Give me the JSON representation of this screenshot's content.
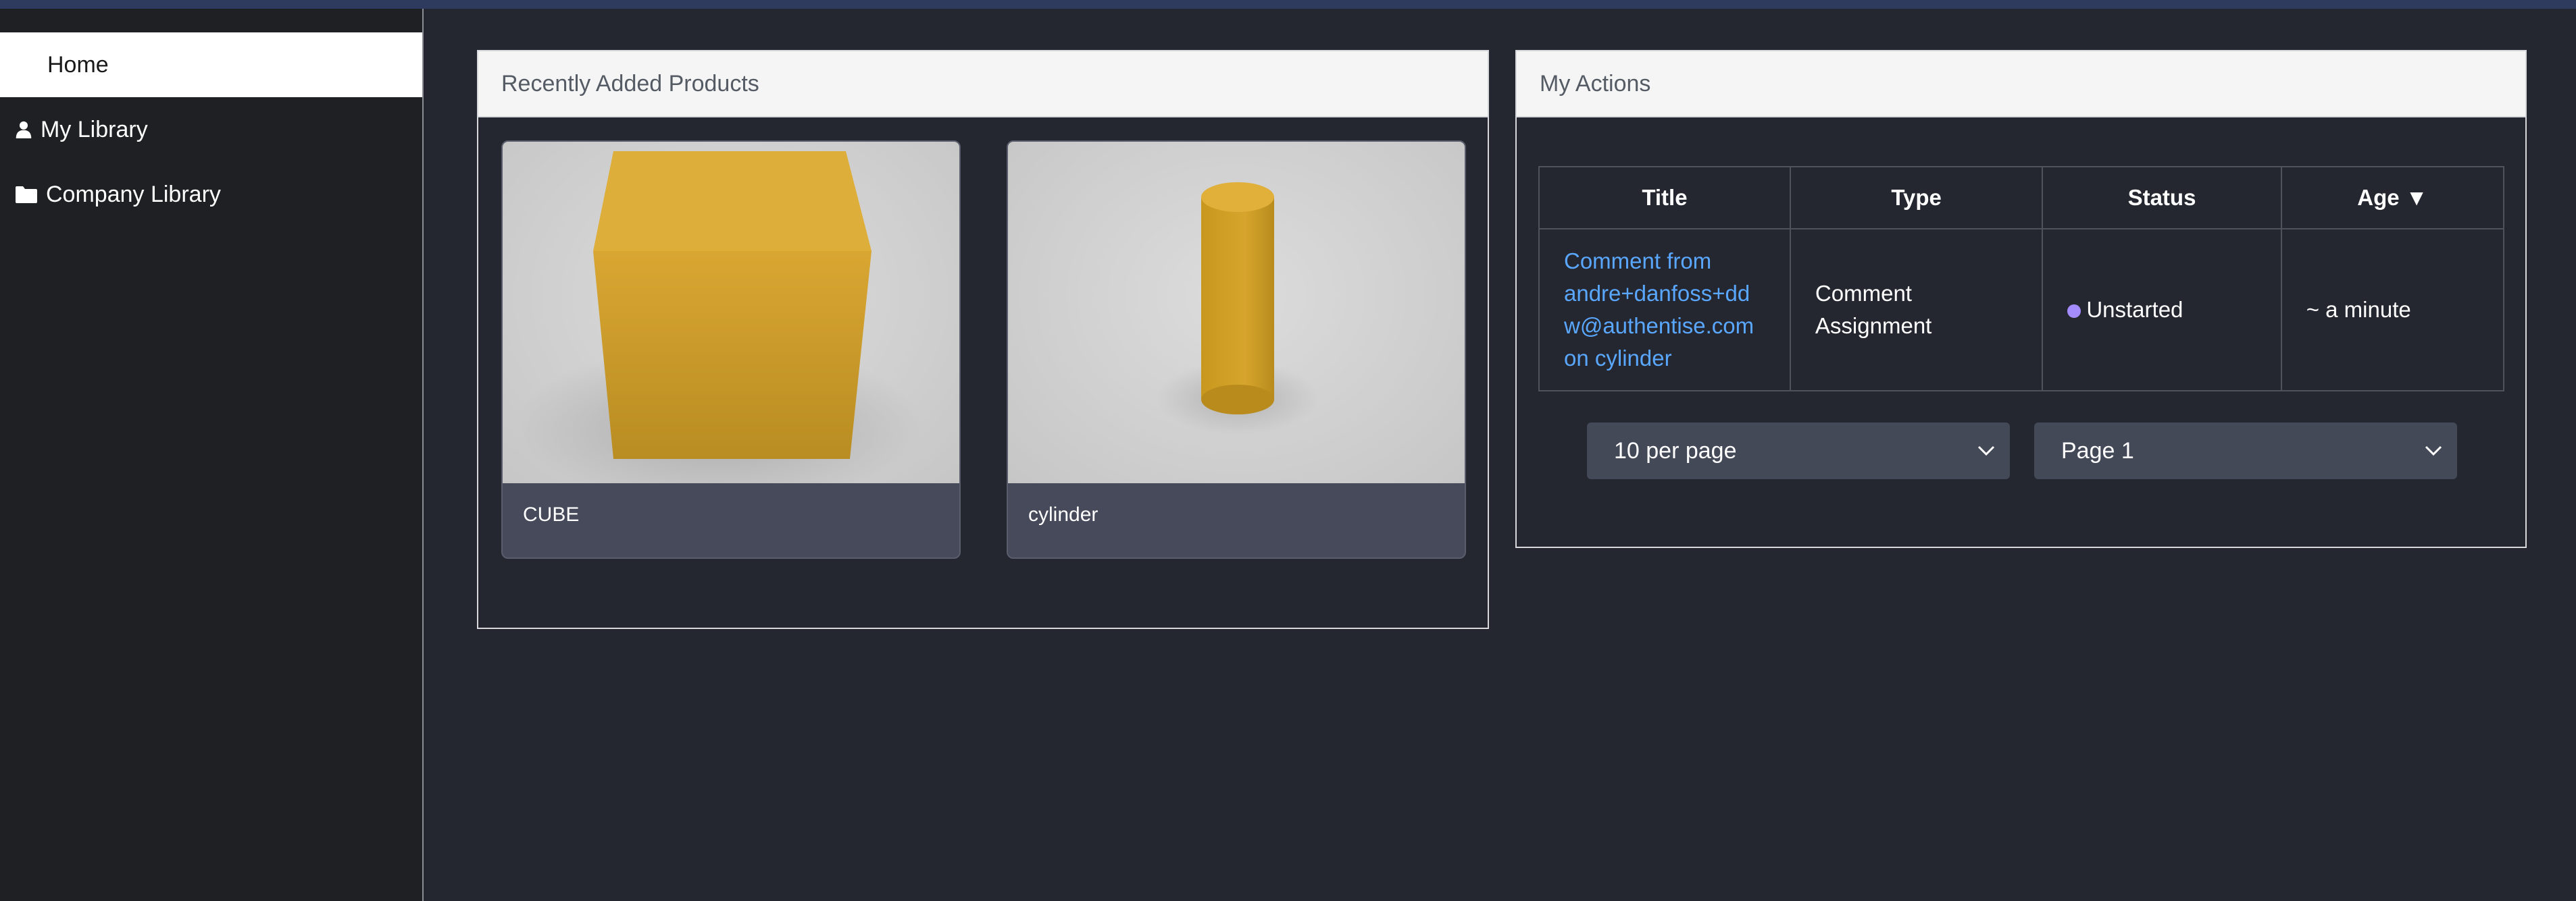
{
  "sidebar": {
    "items": [
      {
        "label": "Home",
        "icon": "home"
      },
      {
        "label": "My Library",
        "icon": "user-icon"
      },
      {
        "label": "Company Library",
        "icon": "folder-icon"
      }
    ]
  },
  "recent_products": {
    "title": "Recently Added Products",
    "items": [
      {
        "name": "CUBE"
      },
      {
        "name": "cylinder"
      }
    ]
  },
  "my_actions": {
    "title": "My Actions",
    "columns": [
      "Title",
      "Type",
      "Status",
      "Age ▼"
    ],
    "rows": [
      {
        "title_lines": [
          "Comment from",
          "andre+danfoss+dd",
          "w@authentise.com",
          "on cylinder"
        ],
        "type_lines": [
          "Comment",
          "Assignment"
        ],
        "status": "Unstarted",
        "age": "~ a minute"
      }
    ],
    "per_page": "10 per page",
    "page": "Page 1"
  },
  "colors": {
    "background": "#24272f",
    "sidebar": "#1f2023",
    "link": "#5aa7ff",
    "status_unstarted": "#a48cff",
    "product_yellow": "#d9a830"
  }
}
